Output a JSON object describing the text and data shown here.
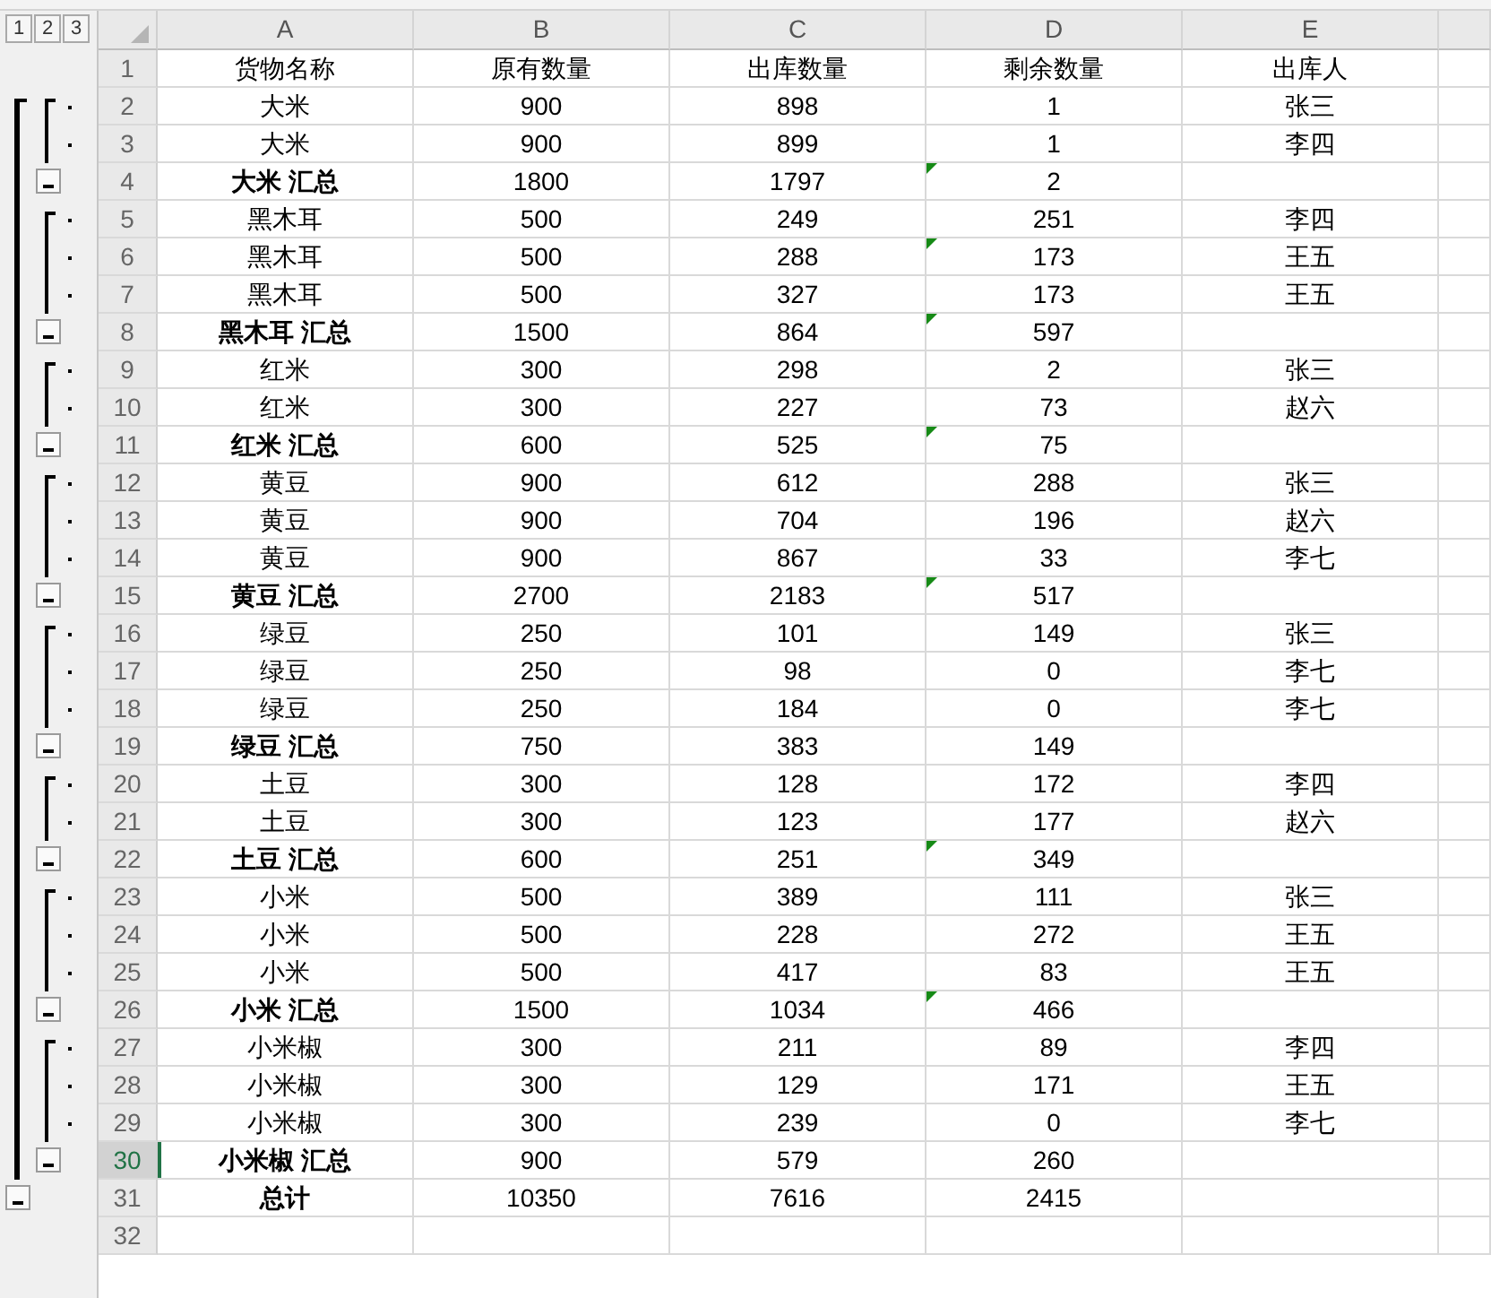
{
  "outline_levels": [
    "1",
    "2",
    "3"
  ],
  "columns": [
    "A",
    "B",
    "C",
    "D",
    "E"
  ],
  "rows": [
    {
      "number": "1",
      "kind": "header",
      "selected": false,
      "flag": false,
      "cells": [
        "货物名称",
        "原有数量",
        "出库数量",
        "剩余数量",
        "出库人"
      ]
    },
    {
      "number": "2",
      "kind": "item",
      "selected": false,
      "flag": false,
      "cells": [
        "大米",
        "900",
        "898",
        "1",
        "张三"
      ]
    },
    {
      "number": "3",
      "kind": "item",
      "selected": false,
      "flag": false,
      "cells": [
        "大米",
        "900",
        "899",
        "1",
        "李四"
      ]
    },
    {
      "number": "4",
      "kind": "subtotal",
      "selected": false,
      "flag": true,
      "cells": [
        "大米 汇总",
        "1800",
        "1797",
        "2",
        ""
      ]
    },
    {
      "number": "5",
      "kind": "item",
      "selected": false,
      "flag": false,
      "cells": [
        "黑木耳",
        "500",
        "249",
        "251",
        "李四"
      ]
    },
    {
      "number": "6",
      "kind": "item",
      "selected": false,
      "flag": true,
      "cells": [
        "黑木耳",
        "500",
        "288",
        "173",
        "王五"
      ]
    },
    {
      "number": "7",
      "kind": "item",
      "selected": false,
      "flag": false,
      "cells": [
        "黑木耳",
        "500",
        "327",
        "173",
        "王五"
      ]
    },
    {
      "number": "8",
      "kind": "subtotal",
      "selected": false,
      "flag": true,
      "cells": [
        "黑木耳 汇总",
        "1500",
        "864",
        "597",
        ""
      ]
    },
    {
      "number": "9",
      "kind": "item",
      "selected": false,
      "flag": false,
      "cells": [
        "红米",
        "300",
        "298",
        "2",
        "张三"
      ]
    },
    {
      "number": "10",
      "kind": "item",
      "selected": false,
      "flag": false,
      "cells": [
        "红米",
        "300",
        "227",
        "73",
        "赵六"
      ]
    },
    {
      "number": "11",
      "kind": "subtotal",
      "selected": false,
      "flag": true,
      "cells": [
        "红米 汇总",
        "600",
        "525",
        "75",
        ""
      ]
    },
    {
      "number": "12",
      "kind": "item",
      "selected": false,
      "flag": false,
      "cells": [
        "黄豆",
        "900",
        "612",
        "288",
        "张三"
      ]
    },
    {
      "number": "13",
      "kind": "item",
      "selected": false,
      "flag": false,
      "cells": [
        "黄豆",
        "900",
        "704",
        "196",
        "赵六"
      ]
    },
    {
      "number": "14",
      "kind": "item",
      "selected": false,
      "flag": false,
      "cells": [
        "黄豆",
        "900",
        "867",
        "33",
        "李七"
      ]
    },
    {
      "number": "15",
      "kind": "subtotal",
      "selected": false,
      "flag": true,
      "cells": [
        "黄豆 汇总",
        "2700",
        "2183",
        "517",
        ""
      ]
    },
    {
      "number": "16",
      "kind": "item",
      "selected": false,
      "flag": false,
      "cells": [
        "绿豆",
        "250",
        "101",
        "149",
        "张三"
      ]
    },
    {
      "number": "17",
      "kind": "item",
      "selected": false,
      "flag": false,
      "cells": [
        "绿豆",
        "250",
        "98",
        "0",
        "李七"
      ]
    },
    {
      "number": "18",
      "kind": "item",
      "selected": false,
      "flag": false,
      "cells": [
        "绿豆",
        "250",
        "184",
        "0",
        "李七"
      ]
    },
    {
      "number": "19",
      "kind": "subtotal",
      "selected": false,
      "flag": false,
      "cells": [
        "绿豆 汇总",
        "750",
        "383",
        "149",
        ""
      ]
    },
    {
      "number": "20",
      "kind": "item",
      "selected": false,
      "flag": false,
      "cells": [
        "土豆",
        "300",
        "128",
        "172",
        "李四"
      ]
    },
    {
      "number": "21",
      "kind": "item",
      "selected": false,
      "flag": false,
      "cells": [
        "土豆",
        "300",
        "123",
        "177",
        "赵六"
      ]
    },
    {
      "number": "22",
      "kind": "subtotal",
      "selected": false,
      "flag": true,
      "cells": [
        "土豆 汇总",
        "600",
        "251",
        "349",
        ""
      ]
    },
    {
      "number": "23",
      "kind": "item",
      "selected": false,
      "flag": false,
      "cells": [
        "小米",
        "500",
        "389",
        "111",
        "张三"
      ]
    },
    {
      "number": "24",
      "kind": "item",
      "selected": false,
      "flag": false,
      "cells": [
        "小米",
        "500",
        "228",
        "272",
        "王五"
      ]
    },
    {
      "number": "25",
      "kind": "item",
      "selected": false,
      "flag": false,
      "cells": [
        "小米",
        "500",
        "417",
        "83",
        "王五"
      ]
    },
    {
      "number": "26",
      "kind": "subtotal",
      "selected": false,
      "flag": true,
      "cells": [
        "小米 汇总",
        "1500",
        "1034",
        "466",
        ""
      ]
    },
    {
      "number": "27",
      "kind": "item",
      "selected": false,
      "flag": false,
      "cells": [
        "小米椒",
        "300",
        "211",
        "89",
        "李四"
      ]
    },
    {
      "number": "28",
      "kind": "item",
      "selected": false,
      "flag": false,
      "cells": [
        "小米椒",
        "300",
        "129",
        "171",
        "王五"
      ]
    },
    {
      "number": "29",
      "kind": "item",
      "selected": false,
      "flag": false,
      "cells": [
        "小米椒",
        "300",
        "239",
        "0",
        "李七"
      ]
    },
    {
      "number": "30",
      "kind": "subtotal",
      "selected": true,
      "flag": false,
      "cells": [
        "小米椒 汇总",
        "900",
        "579",
        "260",
        ""
      ]
    },
    {
      "number": "31",
      "kind": "total",
      "selected": false,
      "flag": false,
      "cells": [
        "总计",
        "10350",
        "7616",
        "2415",
        ""
      ]
    },
    {
      "number": "32",
      "kind": "blank",
      "selected": false,
      "flag": false,
      "cells": [
        "",
        "",
        "",
        "",
        ""
      ]
    }
  ]
}
